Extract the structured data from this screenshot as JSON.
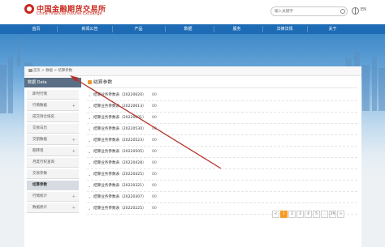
{
  "header": {
    "logo_cn": "中国金融期货交易所",
    "logo_en": "China Financial Futures Exchange",
    "search_placeholder": "输入关键字",
    "language": "EN"
  },
  "nav": [
    "首页",
    "新闻公告",
    "产品",
    "数据",
    "服务",
    "法律法规",
    "关于"
  ],
  "breadcrumb": "首页 > 数据 > 结算参数",
  "sidebar": {
    "title": "数据 Data",
    "items": [
      {
        "label": "即时行情",
        "plus": false
      },
      {
        "label": "行情数据",
        "plus": true
      },
      {
        "label": "成交持仓排名",
        "plus": false
      },
      {
        "label": "交易日历",
        "plus": false
      },
      {
        "label": "交割数据",
        "plus": true
      },
      {
        "label": "期转现",
        "plus": true
      },
      {
        "label": "月度行权查询",
        "plus": false
      },
      {
        "label": "交易参数",
        "plus": false
      },
      {
        "label": "结算参数",
        "plus": false,
        "active": true
      },
      {
        "label": "行情统计",
        "plus": true
      },
      {
        "label": "数据统计",
        "plus": true
      }
    ]
  },
  "content": {
    "title": "结算参数",
    "rows": [
      {
        "label": "结算业务参数表（20220620）",
        "value": "00"
      },
      {
        "label": "结算业务参数表（20220613）",
        "value": "00"
      },
      {
        "label": "结算业务参数表（20220601）",
        "value": "00"
      },
      {
        "label": "结算业务参数表（20220530）",
        "value": "00"
      },
      {
        "label": "结算业务参数表（20220523）",
        "value": "00"
      },
      {
        "label": "结算业务参数表（20220505）",
        "value": "00"
      },
      {
        "label": "结算业务参数表（20220428）",
        "value": "00"
      },
      {
        "label": "结算业务参数表（20220425）",
        "value": "00"
      },
      {
        "label": "结算业务参数表（20220321）",
        "value": "00"
      },
      {
        "label": "结算业务参数表（20220307）",
        "value": "00"
      },
      {
        "label": "结算业务参数表（20220225）",
        "value": "00"
      }
    ]
  },
  "pager": [
    "<",
    "1",
    "2",
    "3",
    "4",
    "5",
    "…",
    "29",
    ">"
  ],
  "pager_current": "1",
  "watermark": "知乎 @当日知期",
  "colors": {
    "accent": "#c8281d",
    "nav": "#1d6bb5",
    "pager_active": "#f59b23",
    "arrow": "#b5322a"
  }
}
